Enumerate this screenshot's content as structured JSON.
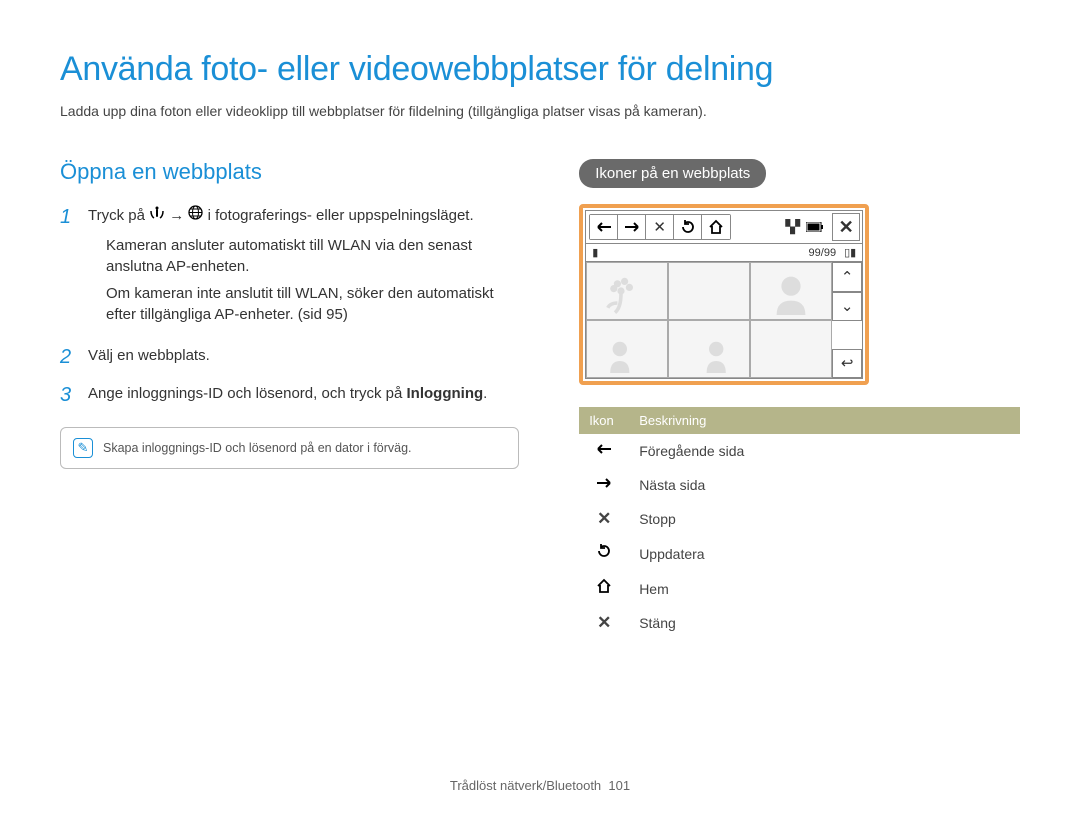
{
  "page": {
    "title": "Använda foto- eller videowebbplatser för delning",
    "intro": "Ladda upp dina foton eller videoklipp till webbplatser för fildelning (tillgängliga platser visas på kameran)."
  },
  "left": {
    "heading": "Öppna en webbplats",
    "steps": [
      {
        "num": "1",
        "pre": "Tryck på ",
        "mid": " → ",
        "post": " i fotograferings- eller uppspelningsläget.",
        "sub": [
          "Kameran ansluter automatiskt till WLAN via den senast anslutna AP-enheten.",
          "Om kameran inte anslutit till WLAN, söker den automatiskt efter tillgängliga AP-enheter. (sid 95)"
        ]
      },
      {
        "num": "2",
        "text": "Välj en webbplats."
      },
      {
        "num": "3",
        "pre": "Ange inloggnings-ID och lösenord, och tryck på ",
        "bold": "Inloggning",
        "post": "."
      }
    ],
    "note": "Skapa inloggnings-ID och lösenord på en dator i förväg."
  },
  "right": {
    "pill": "Ikoner på en webbplats",
    "counter": "99/99",
    "table": {
      "headers": [
        "Ikon",
        "Beskrivning"
      ],
      "rows": [
        {
          "icon": "prev",
          "desc": "Föregående sida"
        },
        {
          "icon": "next",
          "desc": "Nästa sida"
        },
        {
          "icon": "stop",
          "desc": "Stopp"
        },
        {
          "icon": "refresh",
          "desc": "Uppdatera"
        },
        {
          "icon": "home",
          "desc": "Hem"
        },
        {
          "icon": "close",
          "desc": "Stäng"
        }
      ]
    }
  },
  "footer": {
    "section": "Trådlöst nätverk/Bluetooth",
    "page": "101"
  }
}
